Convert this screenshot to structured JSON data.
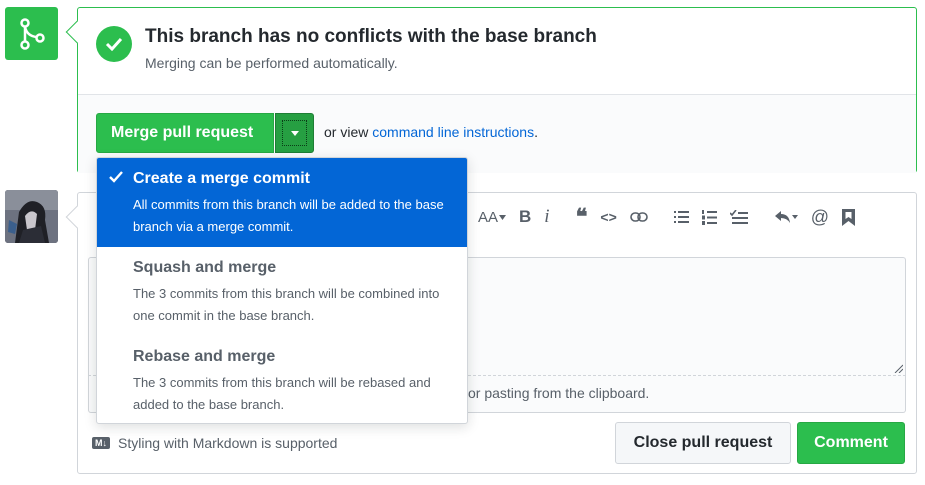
{
  "merge_status": {
    "title": "This branch has no conflicts with the base branch",
    "subtitle": "Merging can be performed automatically."
  },
  "merge_actions": {
    "merge_button_label": "Merge pull request",
    "alt_text_prefix": "or view",
    "alt_link_label": "command line instructions",
    "alt_text_suffix": "."
  },
  "merge_menu": {
    "items": [
      {
        "title": "Create a merge commit",
        "description": "All commits from this branch will be added to the base branch via a merge commit.",
        "selected": true
      },
      {
        "title": "Squash and merge",
        "description": "The 3 commits from this branch will be combined into one commit in the base branch.",
        "selected": false
      },
      {
        "title": "Rebase and merge",
        "description": "The 3 commits from this branch will be rebased and added to the base branch.",
        "selected": false
      }
    ]
  },
  "editor": {
    "toolbar": {
      "heading": "AA",
      "bold": "B",
      "italic": "i",
      "quote": "❝",
      "code": "<>"
    },
    "drop_hint": "or pasting from the clipboard.",
    "markdown_note": "Styling with Markdown is supported",
    "close_button_label": "Close pull request",
    "comment_button_label": "Comment"
  },
  "icons": [
    "git-merge-icon",
    "check-icon",
    "triangle-down-icon",
    "heading-icon",
    "bold-icon",
    "italic-icon",
    "quote-icon",
    "code-icon",
    "link-icon",
    "unordered-list-icon",
    "ordered-list-icon",
    "task-list-icon",
    "reply-icon",
    "mention-icon",
    "bookmark-icon",
    "markdown-icon",
    "resize-handle-icon",
    "avatar"
  ],
  "colors": {
    "success": "#2cbe4e",
    "success_dark": "#269f42",
    "link": "#0366d6",
    "selected_bg": "#0366d6",
    "muted_text": "#586069",
    "border": "#d1d5da"
  }
}
